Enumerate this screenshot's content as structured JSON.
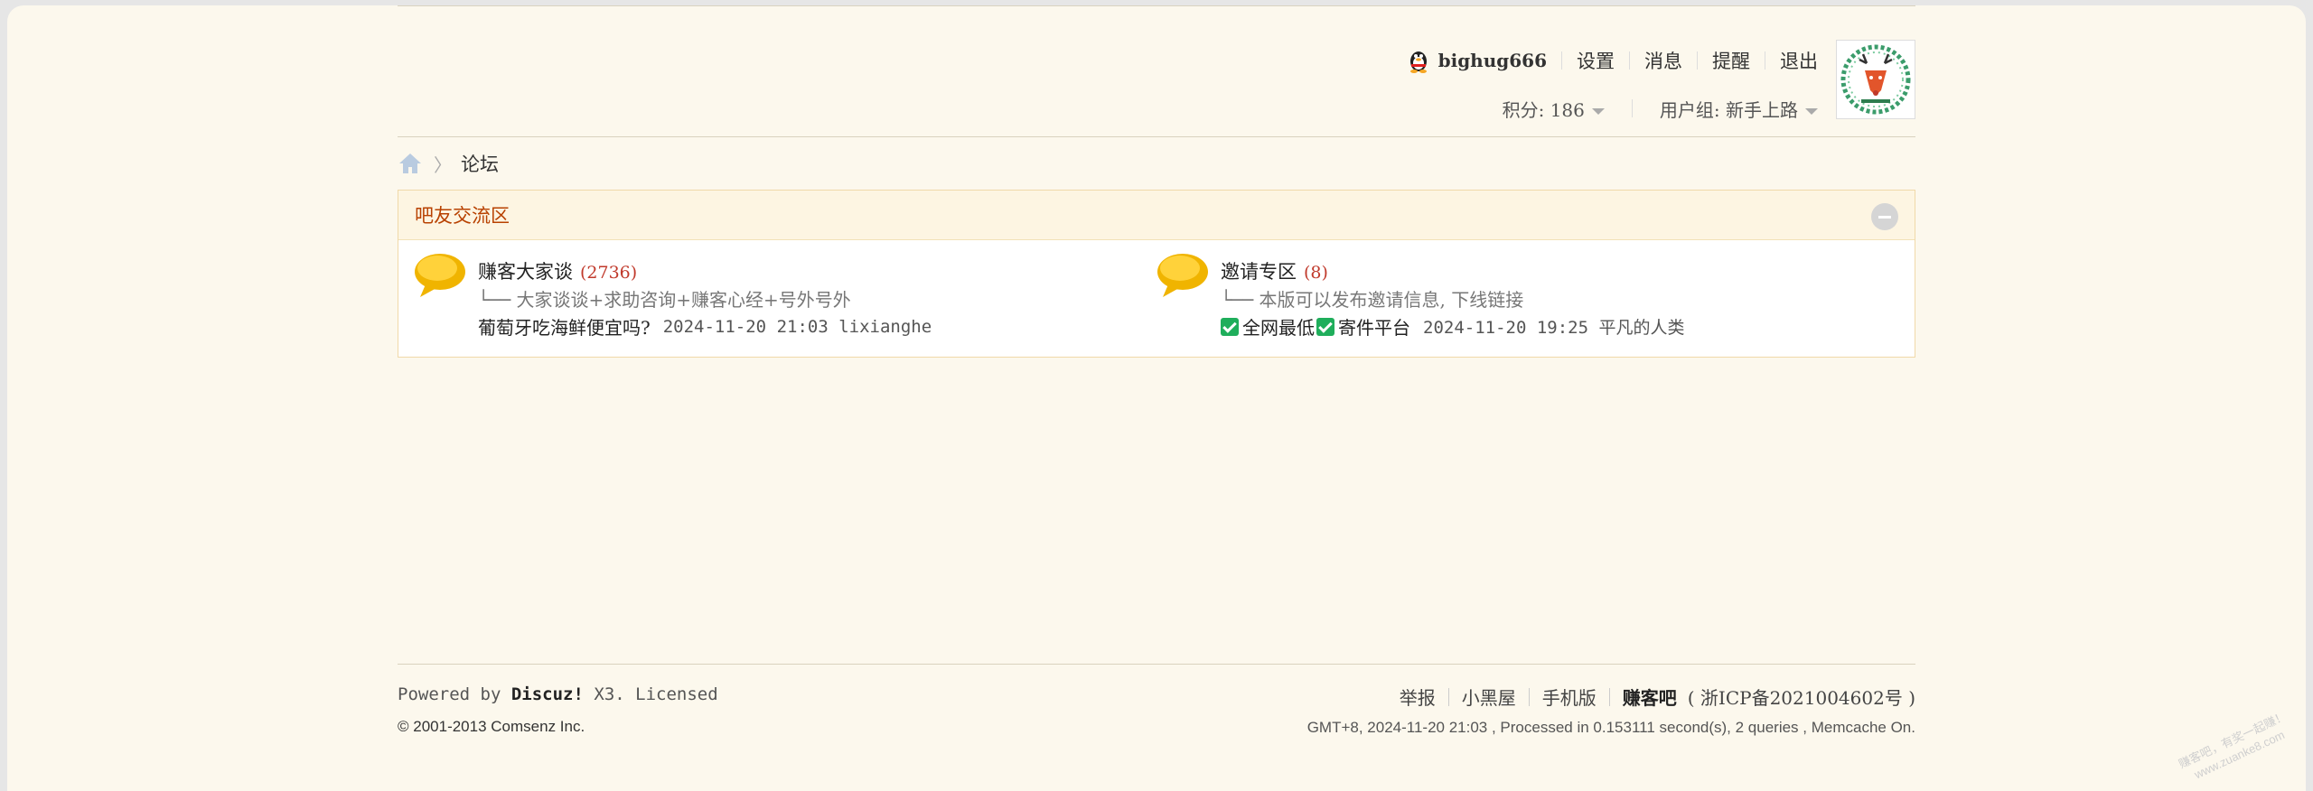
{
  "user": {
    "name": "bighug666",
    "links": [
      "设置",
      "消息",
      "提醒",
      "退出"
    ],
    "points_label": "积分: 186",
    "group_label": "用户组: 新手上路"
  },
  "breadcrumb": {
    "current": "论坛"
  },
  "category": {
    "title": "吧友交流区",
    "forums": [
      {
        "name": "赚客大家谈",
        "count": "(2736)",
        "desc": "└── 大家谈谈+求助咨询+赚客心经+号外号外",
        "last_title": "葡萄牙吃海鲜便宜吗?",
        "last_meta": "2024-11-20 21:03 lixianghe"
      },
      {
        "name": "邀请专区",
        "count": "(8)",
        "desc": "└── 本版可以发布邀请信息, 下线链接",
        "last_title_part1": "全网最低",
        "last_title_part2": "寄件平台",
        "last_meta": "2024-11-20 19:25 平凡的人类"
      }
    ]
  },
  "footer": {
    "powered_prefix": "Powered by",
    "powered_brand": "Discuz!",
    "powered_suffix": "X3. Licensed",
    "copyright_prefix": "© 2001-2013",
    "copyright_company": "Comsenz Inc.",
    "links": [
      "举报",
      "小黑屋",
      "手机版"
    ],
    "site_name": "赚客吧",
    "icp": "( 浙ICP备2021004602号 )",
    "status": "GMT+8, 2024-11-20 21:03 , Processed in 0.153111 second(s), 2 queries , Memcache On."
  },
  "watermark": {
    "line1": "赚客吧，有奖一起赚！",
    "line2": "www.zuanke8.com"
  },
  "colors": {
    "accent": "#b84100",
    "count": "#c0392b",
    "check": "#1fae5b"
  }
}
